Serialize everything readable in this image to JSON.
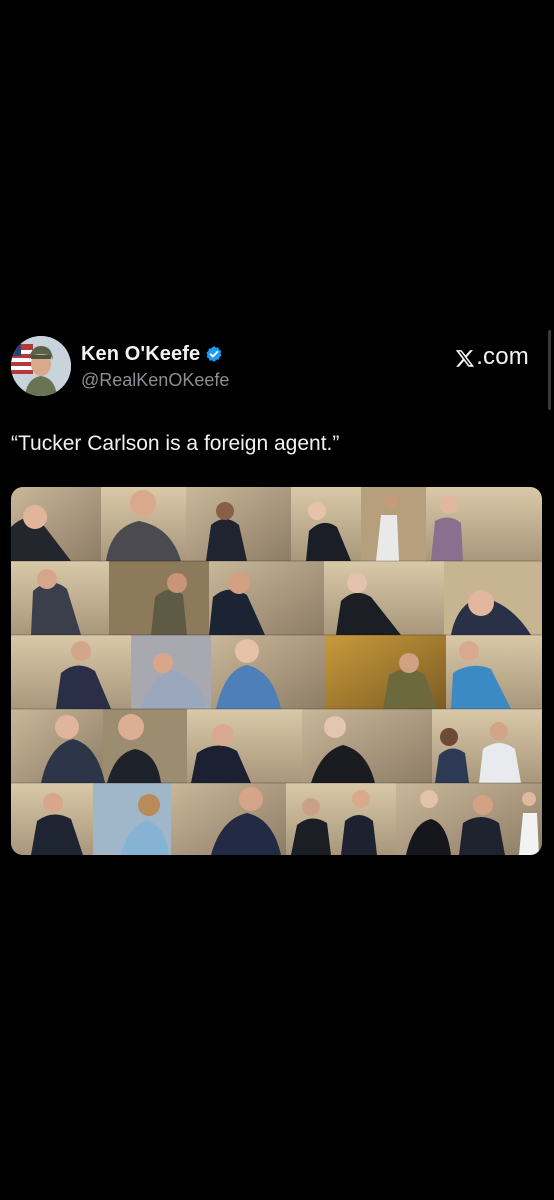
{
  "tweet": {
    "author_name": "Ken O'Keefe",
    "author_handle": "@RealKenOKeefe",
    "verified": true,
    "brand_label": ".com",
    "text": "“Tucker Carlson is a foreign agent.”"
  },
  "colors": {
    "background": "#000000",
    "text": "#f2f2f2",
    "handle": "#8b8f94",
    "verified": "#1d9bf0"
  },
  "icons": [
    "x-logo-icon",
    "verified-badge-icon",
    "avatar"
  ],
  "media": {
    "kind": "photo-collage",
    "rows": 5
  }
}
